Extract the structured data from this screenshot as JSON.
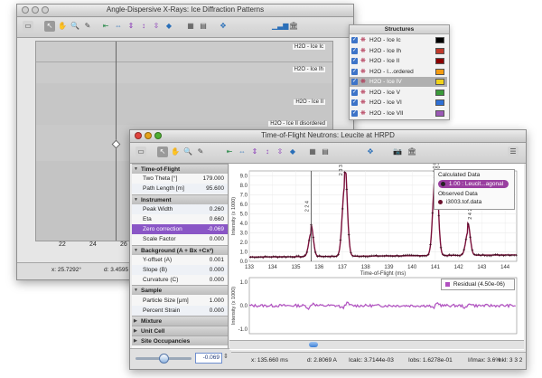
{
  "win1": {
    "title": "Angle-Dispersive X-Rays: Ice Diffraction Patterns",
    "traces": [
      "H2O - Ice Ic",
      "H2O - Ice Ih",
      "H2O - Ice II",
      "H2O - Ice II disordered"
    ],
    "xticks": [
      "22",
      "24",
      "26"
    ],
    "status_x": "x: 25.7292°",
    "status_d": "d: 3.4595 A"
  },
  "structures": {
    "title": "Structures",
    "items": [
      {
        "label": "H2O - Ice Ic",
        "color": "#000000",
        "selected": false
      },
      {
        "label": "H2O - Ice Ih",
        "color": "#c0392b",
        "selected": false
      },
      {
        "label": "H2O - Ice II",
        "color": "#8b0000",
        "selected": false
      },
      {
        "label": "H2O - I...ordered",
        "color": "#f39c12",
        "selected": false
      },
      {
        "label": "H2O - Ice IV",
        "color": "#f1d21a",
        "selected": true
      },
      {
        "label": "H2O - Ice V",
        "color": "#3a9a3a",
        "selected": false
      },
      {
        "label": "H2O - Ice VI",
        "color": "#2d6fd6",
        "selected": false
      },
      {
        "label": "H2O - Ice VII",
        "color": "#9b59b6",
        "selected": false
      }
    ]
  },
  "win2": {
    "title": "Time-of-Flight Neutrons: Leucite at HRPD",
    "panel": [
      {
        "kind": "header",
        "label": "Time-of-Flight"
      },
      {
        "kind": "row",
        "label": "Two Theta [°]",
        "value": "179.000"
      },
      {
        "kind": "row",
        "label": "Path Length [m]",
        "value": "95.600"
      },
      {
        "kind": "header",
        "label": "Instrument"
      },
      {
        "kind": "row",
        "label": "Peak Width",
        "value": "0.260"
      },
      {
        "kind": "row",
        "label": "Eta",
        "value": "0.660"
      },
      {
        "kind": "selected",
        "label": "Zero correction",
        "value": "-0.069"
      },
      {
        "kind": "row",
        "label": "Scale Factor",
        "value": "0.000"
      },
      {
        "kind": "header",
        "label": "Background (A + Bx +Cx²)"
      },
      {
        "kind": "row",
        "label": "Y-offset (A)",
        "value": "0.001"
      },
      {
        "kind": "row",
        "label": "Slope (B)",
        "value": "0.000"
      },
      {
        "kind": "row",
        "label": "Curvature (C)",
        "value": "0.000"
      },
      {
        "kind": "header",
        "label": "Sample"
      },
      {
        "kind": "row",
        "label": "Particle Size [μm]",
        "value": "1.000"
      },
      {
        "kind": "row",
        "label": "Percent Strain",
        "value": "0.000"
      },
      {
        "kind": "header",
        "label": "Mixture"
      },
      {
        "kind": "header",
        "label": "Unit Cell"
      },
      {
        "kind": "header",
        "label": "Site Occupancies"
      }
    ],
    "slider_value": "-0.069",
    "main_ylabel": "Intensity (x 1000)",
    "yticks": [
      "9.0",
      "8.0",
      "7.0",
      "6.0",
      "5.0",
      "4.0",
      "3.0",
      "2.0",
      "1.0",
      "0.0"
    ],
    "xticks": [
      "133",
      "134",
      "135",
      "136",
      "137",
      "138",
      "139",
      "140",
      "141",
      "142",
      "143",
      "144"
    ],
    "xlabel": "Time-of-Flight (ms)",
    "peak_labels": [
      "2 2 4",
      "2 3 3",
      "4 0 0",
      "0 0 4",
      "2 4 2"
    ],
    "legend": {
      "calc_title": "Calculated Data",
      "calc_item": "1.00 : Leucit...agonal",
      "obs_title": "Observed Data",
      "obs_item": "i3003.tof.data"
    },
    "residual_ylabel": "Intensity (x 1000)",
    "residual_yticks": [
      "1.0",
      "0.0",
      "-1.0"
    ],
    "residual_legend": "Residual (4.50e-06)",
    "status": {
      "x": "x: 135.660 ms",
      "d": "d: 2.8069 A",
      "icalc": "Icalc: 3.7144e-03",
      "iobs": "Iobs: 1.6278e-01",
      "imax": "I/Imax: 3.6%",
      "hkl": "hkl: 3 3 2"
    }
  }
}
